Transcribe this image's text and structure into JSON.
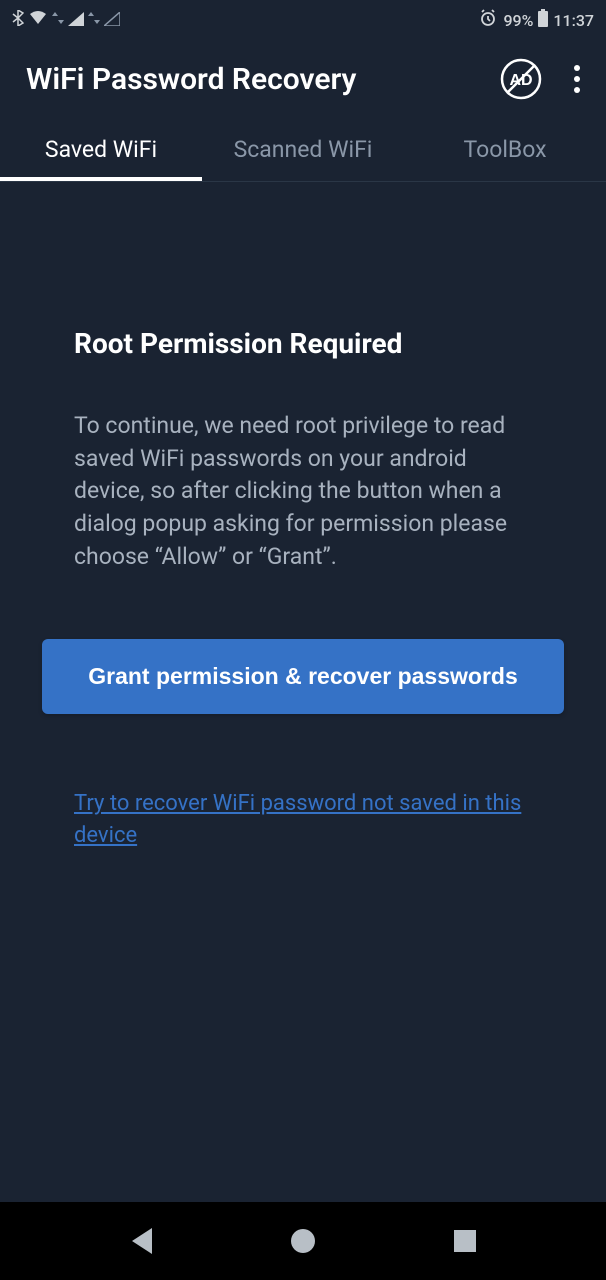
{
  "statusbar": {
    "battery_percent": "99%",
    "time": "11:37"
  },
  "header": {
    "title": "WiFi Password Recovery"
  },
  "tabs": [
    {
      "label": "Saved WiFi",
      "active": true
    },
    {
      "label": "Scanned WiFi",
      "active": false
    },
    {
      "label": "ToolBox",
      "active": false
    }
  ],
  "main": {
    "heading": "Root Permission Required",
    "description": "To continue, we need root privilege to read saved WiFi passwords on your android device, so after clicking the button when a dialog popup asking for permission please choose “Allow” or “Grant”.",
    "primary_button": "Grant permission & recover passwords",
    "link": "Try to recover WiFi password not saved in this device"
  }
}
